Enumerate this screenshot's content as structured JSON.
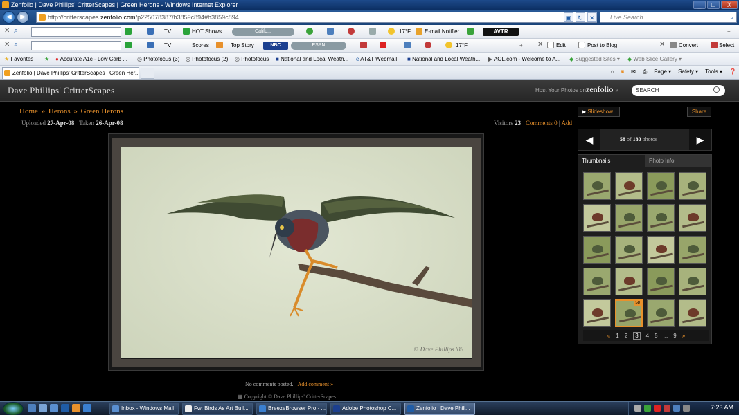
{
  "window": {
    "title": "Zenfolio | Dave Phillips' CritterScapes | Green Herons - Windows Internet Explorer",
    "buttons": [
      "_",
      "□",
      "X"
    ]
  },
  "address_bar": {
    "url_prefix": "http://critterscapes.",
    "url_domain": "zenfolio.com",
    "url_path": "/p225078387/h3859c894#h3859c894",
    "live_search_placeholder": "Live Search"
  },
  "toolbar1": {
    "tv": "TV",
    "hot_shows": "HOT Shows",
    "califo": "Califo...",
    "temp": "17°F",
    "email_notifier": "E-mail Notifier",
    "avtr": "AVTR"
  },
  "toolbar2": {
    "tv": "TV",
    "scores": "Scores",
    "top_story": "Top Story",
    "nbc": "NBC",
    "espn": "ESPN",
    "temp": "17°F",
    "edit": "Edit",
    "post_to_blog": "Post to Blog",
    "convert": "Convert",
    "select": "Select"
  },
  "favorites_bar": {
    "favorites": "Favorites",
    "items": [
      "Accurate A1c - Low Carb ...",
      "Photofocus (3)",
      "Photofocus (2)",
      "Photofocus",
      "National and Local Weath...",
      "AT&T Webmail",
      "National and Local Weath...",
      "AOL.com - Welcome to A...",
      "Suggested Sites",
      "Web Slice Gallery"
    ]
  },
  "tab_bar": {
    "tab_title": "Zenfolio | Dave Phillips' CritterScapes | Green Her...",
    "commands": [
      "Page",
      "Safety",
      "Tools"
    ]
  },
  "site": {
    "title": "Dave Phillips' CritterScapes",
    "host_text": "Host Your Photos on",
    "logo": "zenfolio",
    "search_placeholder": "SEARCH"
  },
  "breadcrumb": {
    "home": "Home",
    "herons": "Herons",
    "current": "Green Herons",
    "separator": "»"
  },
  "meta": {
    "uploaded_label": "Uploaded",
    "uploaded": "27-Apr-08",
    "taken_label": "Taken",
    "taken": "26-Apr-08",
    "visitors_label": "Visitors",
    "visitors": "23",
    "comments": "Comments 0",
    "add": "Add",
    "divider": "|"
  },
  "photo": {
    "watermark": "© Dave Phillips '08"
  },
  "comments": {
    "none": "No comments posted.",
    "add": "Add comment »"
  },
  "footer": {
    "copyright": "Copyright © Dave Phillips' CritterScapes"
  },
  "sidebar": {
    "slideshow": "Slideshow",
    "share": "Share",
    "photo_index": "58",
    "of": "of",
    "total": "180",
    "photos": "photos",
    "tabs": [
      "Thumbnails",
      "Photo Info"
    ],
    "current_badge": "58",
    "pages": [
      "«",
      "1",
      "2",
      "3",
      "4",
      "5",
      "...",
      "9",
      "»"
    ],
    "current_page": "3"
  },
  "taskbar": {
    "tasks": [
      "Inbox - Windows Mail",
      "Fw: Birds As Art Bull...",
      "BreezeBrowser Pro - ...",
      "Adobe Photoshop C...",
      "Zenfolio | Dave Phill..."
    ],
    "clock": "7:23 AM"
  }
}
